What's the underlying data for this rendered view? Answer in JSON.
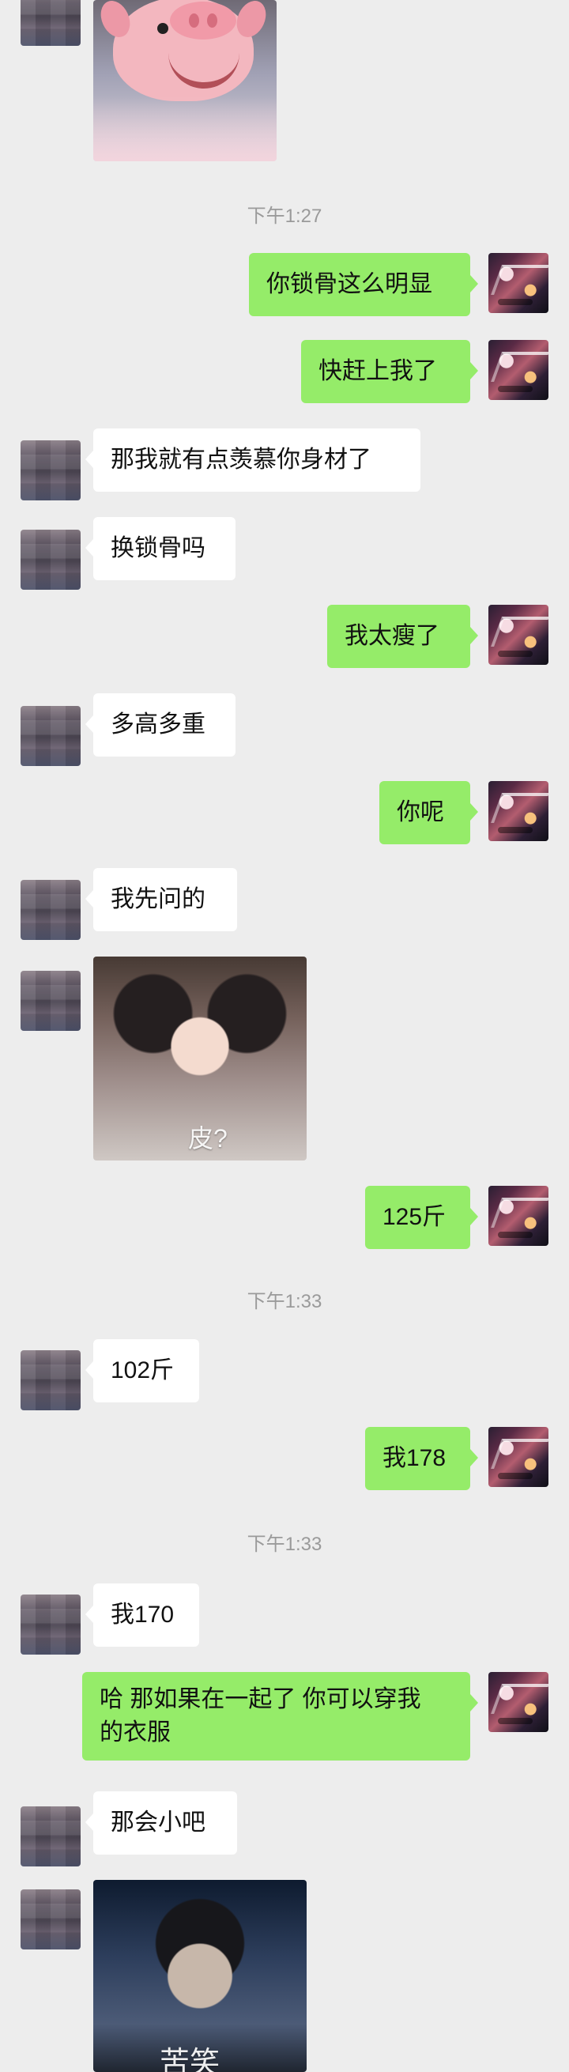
{
  "timestamps": [
    "下午1:27",
    "下午1:33",
    "下午1:33"
  ],
  "messages": {
    "m1": "你锁骨这么明显",
    "m2": "快赶上我了",
    "m3": "那我就有点羡慕你身材了",
    "m4": "换锁骨吗",
    "m5": "我太瘦了",
    "m6": "多高多重",
    "m7": "你呢",
    "m8": "我先问的",
    "m9": "125斤",
    "m10": "102斤",
    "m11": "我178",
    "m12": "我170",
    "m13_line1": "哈 那如果在一起了 你可以穿我",
    "m13_line2": "的衣服",
    "m14": "那会小吧"
  },
  "media": {
    "sticker_face_caption": "皮?",
    "sticker_bottom_caption": "苦笑"
  },
  "colors": {
    "background": "#ededed",
    "received_bubble": "#ffffff",
    "sent_bubble": "#95ec69",
    "timestamp_text": "#9a9a9a"
  }
}
